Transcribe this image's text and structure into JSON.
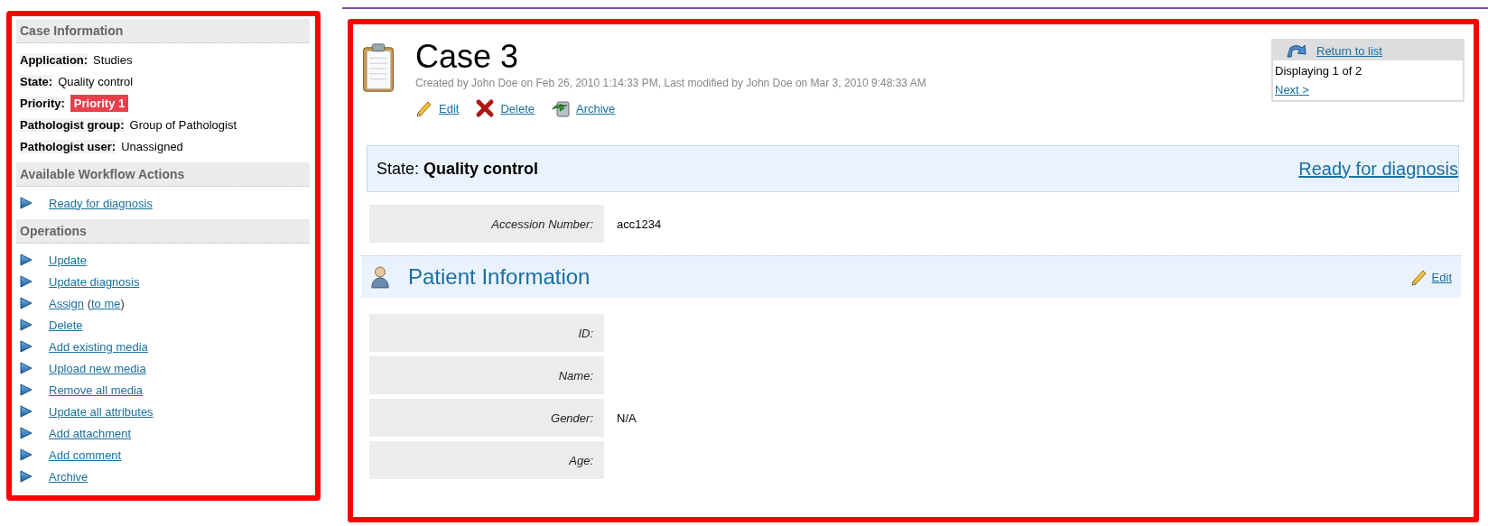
{
  "case_information": {
    "title": "Case Information",
    "fields": [
      {
        "label": "Application:",
        "value": "Studies",
        "kind": "text"
      },
      {
        "label": "State:",
        "value": "Quality control",
        "kind": "text"
      },
      {
        "label": "Priority:",
        "value": "Priority 1",
        "kind": "badge"
      },
      {
        "label": "Pathologist group:",
        "value": "Group of Pathologist",
        "kind": "text"
      },
      {
        "label": "Pathologist user:",
        "value": "Unassigned",
        "kind": "text"
      }
    ]
  },
  "workflow_actions": {
    "title": "Available Workflow Actions",
    "items": [
      {
        "parts": [
          {
            "text": "Ready for diagnosis",
            "kind": "link"
          }
        ]
      }
    ]
  },
  "operations": {
    "title": "Operations",
    "items": [
      {
        "parts": [
          {
            "text": "Update",
            "kind": "link"
          }
        ]
      },
      {
        "parts": [
          {
            "text": "Update diagnosis",
            "kind": "link"
          }
        ]
      },
      {
        "parts": [
          {
            "text": "Assign",
            "kind": "link"
          },
          {
            "text": " (",
            "kind": "text"
          },
          {
            "text": "to me",
            "kind": "link"
          },
          {
            "text": ")",
            "kind": "text"
          }
        ]
      },
      {
        "parts": [
          {
            "text": "Delete",
            "kind": "link"
          }
        ]
      },
      {
        "parts": [
          {
            "text": "Add existing media",
            "kind": "link"
          }
        ]
      },
      {
        "parts": [
          {
            "text": "Upload new media",
            "kind": "link"
          }
        ]
      },
      {
        "parts": [
          {
            "text": "Remove all media",
            "kind": "link"
          }
        ]
      },
      {
        "parts": [
          {
            "text": "Update all attributes",
            "kind": "link"
          }
        ]
      },
      {
        "parts": [
          {
            "text": "Add attachment",
            "kind": "link"
          }
        ]
      },
      {
        "parts": [
          {
            "text": "Add comment",
            "kind": "link"
          }
        ]
      },
      {
        "parts": [
          {
            "text": "Archive",
            "kind": "link"
          }
        ]
      }
    ]
  },
  "case": {
    "title": "Case 3",
    "meta": "Created by John Doe on Feb 26, 2010 1:14:33 PM, Last modified by John Doe on Mar 3, 2010 9:48:33 AM",
    "actions": [
      {
        "label": "Edit",
        "kind": "edit"
      },
      {
        "label": "Delete",
        "kind": "delete"
      },
      {
        "label": "Archive",
        "kind": "archive"
      }
    ]
  },
  "pager": {
    "return_label": "Return to list",
    "status": "Displaying 1 of 2",
    "next": "Next >"
  },
  "state_bar": {
    "label": "State:",
    "value": "Quality control",
    "action": "Ready for diagnosis"
  },
  "fields": [
    {
      "label": "Accession Number:",
      "value": "acc1234"
    }
  ],
  "patient_information": {
    "title": "Patient Information",
    "edit": "Edit",
    "fields": [
      {
        "label": "ID:"
      },
      {
        "label": "Name:"
      },
      {
        "label": "Gender:",
        "value": "N/A"
      },
      {
        "label": "Age:"
      }
    ]
  }
}
